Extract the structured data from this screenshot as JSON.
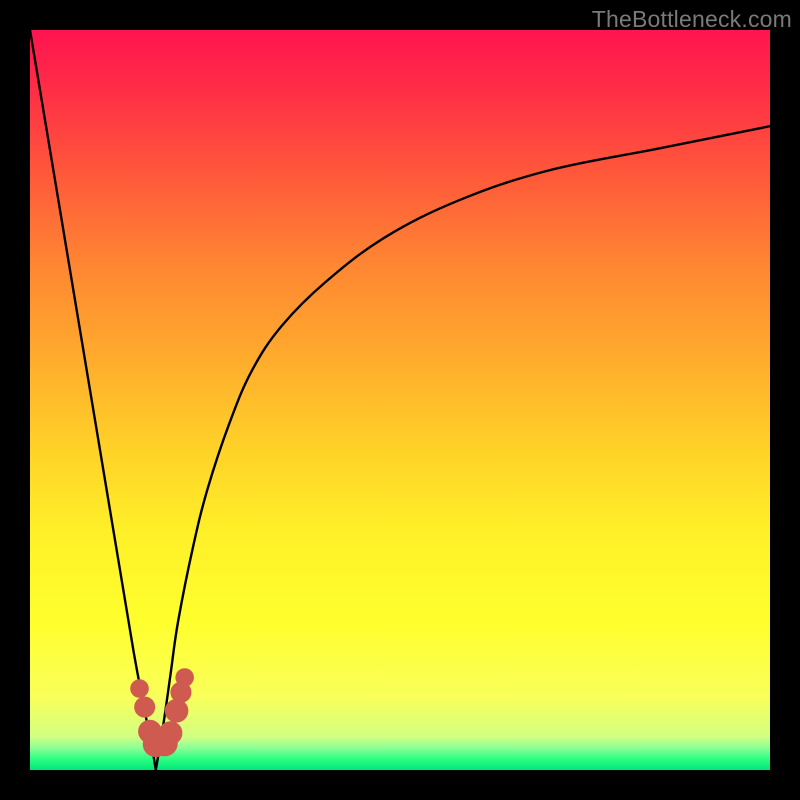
{
  "watermark": "TheBottleneck.com",
  "colors": {
    "border": "#000000",
    "curve": "#000000",
    "marker_fill": "#cf5a50",
    "marker_stroke": "#b94a40"
  },
  "chart_data": {
    "type": "line",
    "title": "",
    "xlabel": "",
    "ylabel": "",
    "xlim": [
      0,
      100
    ],
    "ylim": [
      0,
      100
    ],
    "note": "Unlabeled bottleneck curve: V-shaped dip to ~0% at x≈17, left branch from 100% at x=0, right branch asymptotically rising toward ~87% at x=100. Values are visual estimates (no axis labels present).",
    "series": [
      {
        "name": "left-branch",
        "x": [
          0,
          2,
          4,
          6,
          8,
          10,
          12,
          14,
          15.5,
          16.5,
          17
        ],
        "values": [
          100,
          88,
          76,
          64,
          52,
          40,
          28,
          16,
          8,
          3,
          0
        ]
      },
      {
        "name": "right-branch",
        "x": [
          17,
          18,
          19,
          20,
          22,
          24,
          27,
          30,
          34,
          40,
          48,
          58,
          70,
          85,
          100
        ],
        "values": [
          0,
          6,
          13,
          20,
          30,
          38,
          47,
          54,
          60,
          66,
          72,
          77,
          81,
          84,
          87
        ]
      }
    ],
    "markers": {
      "description": "Cluster of rounded markers near the dip, slightly above the green band.",
      "points": [
        {
          "x": 14.8,
          "y": 11.0,
          "r": 1.0
        },
        {
          "x": 15.5,
          "y": 8.5,
          "r": 1.2
        },
        {
          "x": 16.2,
          "y": 5.2,
          "r": 1.4
        },
        {
          "x": 17.0,
          "y": 3.5,
          "r": 1.6
        },
        {
          "x": 18.2,
          "y": 3.6,
          "r": 1.6
        },
        {
          "x": 19.0,
          "y": 5.0,
          "r": 1.4
        },
        {
          "x": 19.8,
          "y": 8.0,
          "r": 1.4
        },
        {
          "x": 20.4,
          "y": 10.5,
          "r": 1.2
        },
        {
          "x": 20.9,
          "y": 12.5,
          "r": 1.0
        }
      ]
    }
  }
}
